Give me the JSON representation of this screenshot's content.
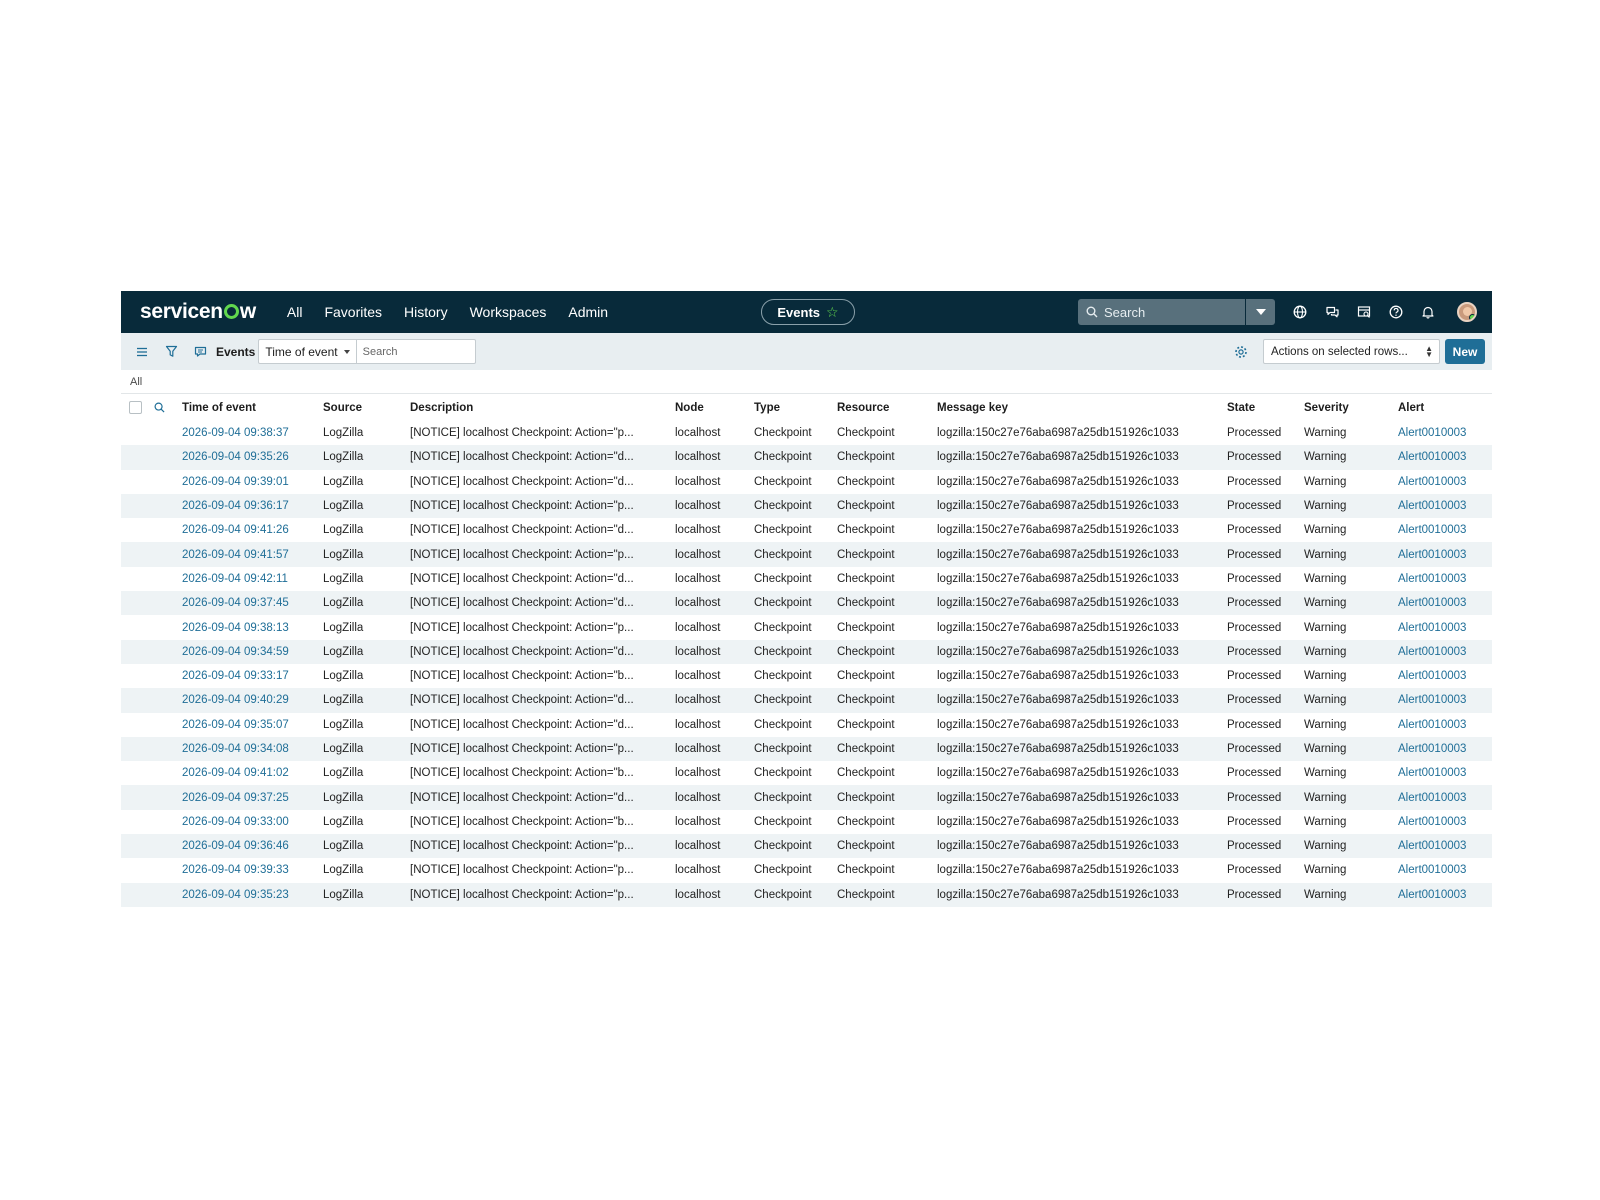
{
  "header": {
    "logo": {
      "pre": "servicen",
      "post": "w"
    },
    "nav": [
      "All",
      "Favorites",
      "History",
      "Workspaces",
      "Admin"
    ],
    "context_pill": "Events",
    "search_placeholder": "Search",
    "icons": [
      "globe-icon",
      "chat-icon",
      "inbox-icon",
      "help-icon",
      "bell-icon"
    ]
  },
  "toolbar": {
    "title": "Events",
    "field_select": "Time of event",
    "search_placeholder": "Search",
    "actions_label": "Actions on selected rows...",
    "new_label": "New"
  },
  "breadcrumb": "All",
  "colors": {
    "nav_bg": "#082a3a",
    "accent": "#1f6e97",
    "brand_green": "#62d84e",
    "toolbar_bg": "#e8eef1",
    "stripe": "#eef3f5"
  },
  "table": {
    "columns": [
      "Time of event",
      "Source",
      "Description",
      "Node",
      "Type",
      "Resource",
      "Message key",
      "State",
      "Severity",
      "Alert"
    ],
    "rows": [
      [
        "2026-09-04 09:38:37",
        "LogZilla",
        "[NOTICE] localhost Checkpoint: Action=\"p...",
        "localhost",
        "Checkpoint",
        "Checkpoint",
        "logzilla:150c27e76aba6987a25db151926c1033",
        "Processed",
        "Warning",
        "Alert0010003"
      ],
      [
        "2026-09-04 09:35:26",
        "LogZilla",
        "[NOTICE] localhost Checkpoint: Action=\"d...",
        "localhost",
        "Checkpoint",
        "Checkpoint",
        "logzilla:150c27e76aba6987a25db151926c1033",
        "Processed",
        "Warning",
        "Alert0010003"
      ],
      [
        "2026-09-04 09:39:01",
        "LogZilla",
        "[NOTICE] localhost Checkpoint: Action=\"d...",
        "localhost",
        "Checkpoint",
        "Checkpoint",
        "logzilla:150c27e76aba6987a25db151926c1033",
        "Processed",
        "Warning",
        "Alert0010003"
      ],
      [
        "2026-09-04 09:36:17",
        "LogZilla",
        "[NOTICE] localhost Checkpoint: Action=\"p...",
        "localhost",
        "Checkpoint",
        "Checkpoint",
        "logzilla:150c27e76aba6987a25db151926c1033",
        "Processed",
        "Warning",
        "Alert0010003"
      ],
      [
        "2026-09-04 09:41:26",
        "LogZilla",
        "[NOTICE] localhost Checkpoint: Action=\"d...",
        "localhost",
        "Checkpoint",
        "Checkpoint",
        "logzilla:150c27e76aba6987a25db151926c1033",
        "Processed",
        "Warning",
        "Alert0010003"
      ],
      [
        "2026-09-04 09:41:57",
        "LogZilla",
        "[NOTICE] localhost Checkpoint: Action=\"p...",
        "localhost",
        "Checkpoint",
        "Checkpoint",
        "logzilla:150c27e76aba6987a25db151926c1033",
        "Processed",
        "Warning",
        "Alert0010003"
      ],
      [
        "2026-09-04 09:42:11",
        "LogZilla",
        "[NOTICE] localhost Checkpoint: Action=\"d...",
        "localhost",
        "Checkpoint",
        "Checkpoint",
        "logzilla:150c27e76aba6987a25db151926c1033",
        "Processed",
        "Warning",
        "Alert0010003"
      ],
      [
        "2026-09-04 09:37:45",
        "LogZilla",
        "[NOTICE] localhost Checkpoint: Action=\"d...",
        "localhost",
        "Checkpoint",
        "Checkpoint",
        "logzilla:150c27e76aba6987a25db151926c1033",
        "Processed",
        "Warning",
        "Alert0010003"
      ],
      [
        "2026-09-04 09:38:13",
        "LogZilla",
        "[NOTICE] localhost Checkpoint: Action=\"p...",
        "localhost",
        "Checkpoint",
        "Checkpoint",
        "logzilla:150c27e76aba6987a25db151926c1033",
        "Processed",
        "Warning",
        "Alert0010003"
      ],
      [
        "2026-09-04 09:34:59",
        "LogZilla",
        "[NOTICE] localhost Checkpoint: Action=\"d...",
        "localhost",
        "Checkpoint",
        "Checkpoint",
        "logzilla:150c27e76aba6987a25db151926c1033",
        "Processed",
        "Warning",
        "Alert0010003"
      ],
      [
        "2026-09-04 09:33:17",
        "LogZilla",
        "[NOTICE] localhost Checkpoint: Action=\"b...",
        "localhost",
        "Checkpoint",
        "Checkpoint",
        "logzilla:150c27e76aba6987a25db151926c1033",
        "Processed",
        "Warning",
        "Alert0010003"
      ],
      [
        "2026-09-04 09:40:29",
        "LogZilla",
        "[NOTICE] localhost Checkpoint: Action=\"d...",
        "localhost",
        "Checkpoint",
        "Checkpoint",
        "logzilla:150c27e76aba6987a25db151926c1033",
        "Processed",
        "Warning",
        "Alert0010003"
      ],
      [
        "2026-09-04 09:35:07",
        "LogZilla",
        "[NOTICE] localhost Checkpoint: Action=\"d...",
        "localhost",
        "Checkpoint",
        "Checkpoint",
        "logzilla:150c27e76aba6987a25db151926c1033",
        "Processed",
        "Warning",
        "Alert0010003"
      ],
      [
        "2026-09-04 09:34:08",
        "LogZilla",
        "[NOTICE] localhost Checkpoint: Action=\"p...",
        "localhost",
        "Checkpoint",
        "Checkpoint",
        "logzilla:150c27e76aba6987a25db151926c1033",
        "Processed",
        "Warning",
        "Alert0010003"
      ],
      [
        "2026-09-04 09:41:02",
        "LogZilla",
        "[NOTICE] localhost Checkpoint: Action=\"b...",
        "localhost",
        "Checkpoint",
        "Checkpoint",
        "logzilla:150c27e76aba6987a25db151926c1033",
        "Processed",
        "Warning",
        "Alert0010003"
      ],
      [
        "2026-09-04 09:37:25",
        "LogZilla",
        "[NOTICE] localhost Checkpoint: Action=\"d...",
        "localhost",
        "Checkpoint",
        "Checkpoint",
        "logzilla:150c27e76aba6987a25db151926c1033",
        "Processed",
        "Warning",
        "Alert0010003"
      ],
      [
        "2026-09-04 09:33:00",
        "LogZilla",
        "[NOTICE] localhost Checkpoint: Action=\"b...",
        "localhost",
        "Checkpoint",
        "Checkpoint",
        "logzilla:150c27e76aba6987a25db151926c1033",
        "Processed",
        "Warning",
        "Alert0010003"
      ],
      [
        "2026-09-04 09:36:46",
        "LogZilla",
        "[NOTICE] localhost Checkpoint: Action=\"p...",
        "localhost",
        "Checkpoint",
        "Checkpoint",
        "logzilla:150c27e76aba6987a25db151926c1033",
        "Processed",
        "Warning",
        "Alert0010003"
      ],
      [
        "2026-09-04 09:39:33",
        "LogZilla",
        "[NOTICE] localhost Checkpoint: Action=\"p...",
        "localhost",
        "Checkpoint",
        "Checkpoint",
        "logzilla:150c27e76aba6987a25db151926c1033",
        "Processed",
        "Warning",
        "Alert0010003"
      ],
      [
        "2026-09-04 09:35:23",
        "LogZilla",
        "[NOTICE] localhost Checkpoint: Action=\"p...",
        "localhost",
        "Checkpoint",
        "Checkpoint",
        "logzilla:150c27e76aba6987a25db151926c1033",
        "Processed",
        "Warning",
        "Alert0010003"
      ]
    ]
  }
}
